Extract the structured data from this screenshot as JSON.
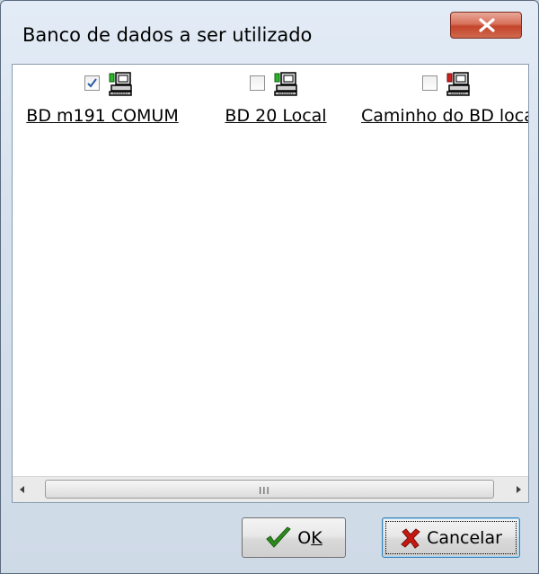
{
  "window": {
    "title": "Banco de dados a ser utilizado"
  },
  "columns": [
    {
      "label": "BD m191 COMUM",
      "checked": true,
      "icon": "computer-green-icon"
    },
    {
      "label": "BD 20 Local",
      "checked": false,
      "icon": "computer-green-icon"
    },
    {
      "label": "Caminho do BD local",
      "checked": false,
      "icon": "computer-red-icon"
    }
  ],
  "scrollbar": {
    "grip": "III"
  },
  "buttons": {
    "ok_pre": "O",
    "ok_accel": "K",
    "cancel_label": "Cancelar"
  },
  "colors": {
    "ok_check": "#2e8b1f",
    "cancel_x": "#c41a10",
    "close_button": "#c4442b"
  }
}
